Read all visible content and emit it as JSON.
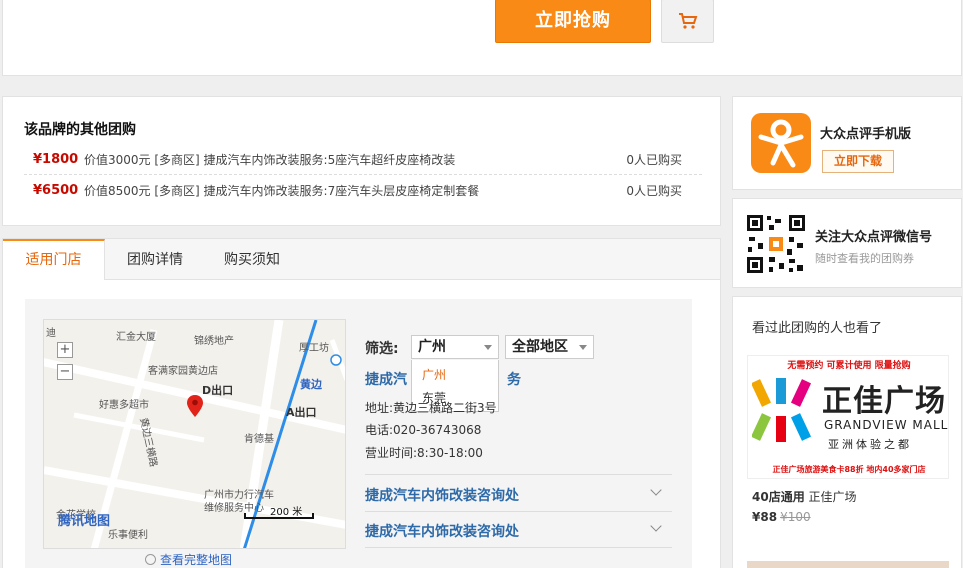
{
  "buy": {
    "label": "立即抢购"
  },
  "other_deals": {
    "title": "该品牌的其他团购",
    "items": [
      {
        "price": "¥1800",
        "desc": "价值3000元 [多商区] 捷成汽车内饰改装服务:5座汽车超纤皮座椅改装",
        "bought": "0人已购买"
      },
      {
        "price": "¥6500",
        "desc": "价值8500元 [多商区] 捷成汽车内饰改装服务:7座汽车头层皮座椅定制套餐",
        "bought": "0人已购买"
      }
    ]
  },
  "tabs": [
    "适用门店",
    "团购详情",
    "购买须知"
  ],
  "map": {
    "labels": [
      "汇金大厦",
      "锦绣地产",
      "厚工坊",
      "客满家园黄边店",
      "D出口",
      "黄边",
      "好惠多超市",
      "A出口",
      "肯德基",
      "黄边三横路",
      "广州市力行汽车",
      "维修服务中心",
      "乐事便利",
      "金花学校",
      "迪"
    ],
    "zoom_in": "+",
    "zoom_out": "−",
    "logo": "腾讯地图",
    "scale": "200 米",
    "full_map_link": "查看完整地图"
  },
  "filter": {
    "label": "筛选:",
    "city_selected": "广州",
    "city_options": [
      "广州",
      "东莞"
    ],
    "area_selected": "全部地区"
  },
  "stores": [
    {
      "name_visible_start": "捷成汽",
      "name_visible_end": "务",
      "address": "地址:黄边三横路二街3号",
      "phone": "电话:020-36743068",
      "hours": "营业时间:8:30-18:00"
    },
    {
      "name": "捷成汽车内饰改装咨询处"
    },
    {
      "name": "捷成汽车内饰改装咨询处"
    }
  ],
  "sidebar": {
    "app_title": "大众点评手机版",
    "app_download": "立即下载",
    "wx_title": "关注大众点评微信号",
    "wx_sub": "随时查看我的团购券",
    "rec_title": "看过此团购的人也看了",
    "rec_banner": {
      "top": "无需预约  可累计使用  限量抢购",
      "cn": "正佳广场",
      "en": "GRANDVIEW MALL",
      "sub": "亚洲体验之都",
      "bottom": "正佳广场旅游美食卡88折 地内40多家门店"
    },
    "rec_caption_bold": "40店通用",
    "rec_caption": "正佳广场",
    "rec_price": "¥88",
    "rec_orig": "¥100"
  },
  "colors": {
    "accent": "#f98a16",
    "price": "#c60a00",
    "link": "#2e6aa8"
  }
}
